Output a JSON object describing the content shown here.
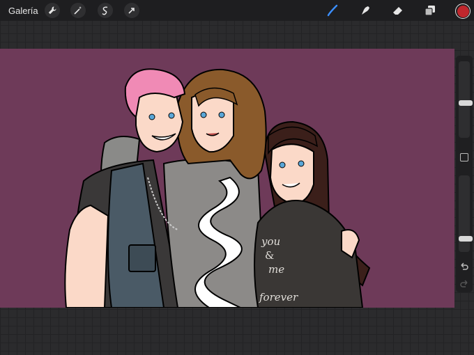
{
  "app": {
    "gallery_label": "Galería"
  },
  "toolbar": {
    "left_tools": [
      "wrench-icon",
      "magic-wand-icon",
      "selection-icon",
      "transform-arrow-icon"
    ],
    "right_tools": [
      "brush-icon",
      "smudge-icon",
      "eraser-icon",
      "layers-icon"
    ],
    "active_tool": "brush-icon",
    "active_color": "#c0272d"
  },
  "sidebar": {
    "brush_size_level": 0.55,
    "opacity_level": 0.85,
    "controls": [
      "modify-button",
      "undo-icon",
      "redo-icon"
    ]
  },
  "canvas": {
    "background_color": "#6e3a59",
    "shirt_text_lines": [
      "you",
      "&",
      "me",
      "forever"
    ]
  }
}
